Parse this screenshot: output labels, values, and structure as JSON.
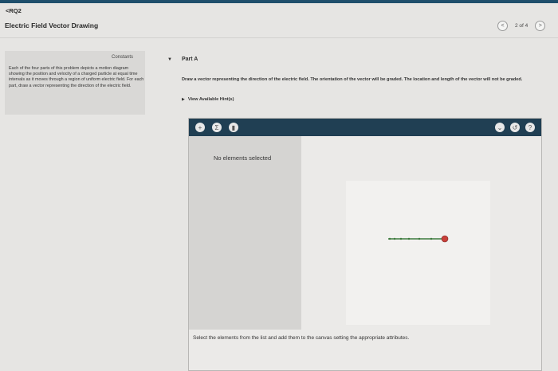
{
  "nav": {
    "back_label": "<RQ2"
  },
  "header": {
    "title": "Electric Field Vector Drawing",
    "pager_text": "2 of 4",
    "prev_glyph": "<",
    "next_glyph": ">"
  },
  "constants": {
    "title": "Constants",
    "text": "Each of the four parts of this problem depicts a motion diagram showing the position and velocity of a charged particle at equal time intervals as it moves through a region of uniform electric field. For each part, draw a vector representing the direction of the electric field."
  },
  "part": {
    "title": "Part A",
    "instructions": "Draw a vector representing the direction of the electric field. The orientation of the vector will be graded. The location and length of the vector will not be graded.",
    "hint_label": "View Available Hint(s)"
  },
  "tool": {
    "add_glyph": "+",
    "sum_glyph": "Σ",
    "trash_glyph": "▮",
    "chevron_glyph": "⌄",
    "reset_glyph": "↺",
    "help_glyph": "?",
    "palette_empty_text": "No elements selected",
    "status_text": "Select the elements from the list and add them to the canvas setting the appropriate attributes."
  },
  "colors": {
    "toolbar": "#203f53",
    "velocity_vector": "#3d7a3d",
    "particle_end": "#c8403a"
  }
}
